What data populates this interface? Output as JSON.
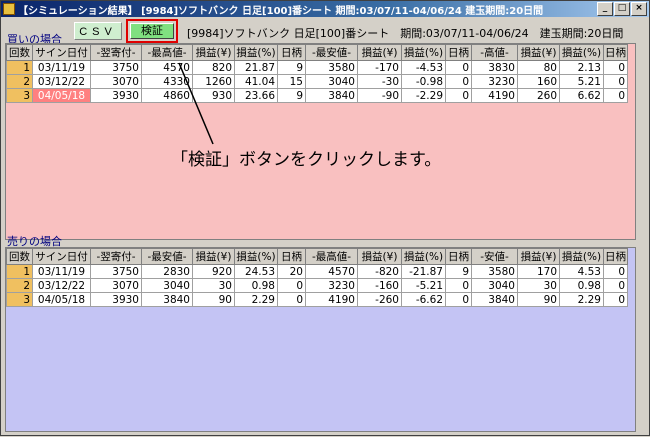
{
  "window": {
    "title": "【シミュレーション結果】 [9984]ソフトバンク 日足[100]番シート 期間:03/07/11-04/06/24 建玉期間:20日間",
    "min_label": "_",
    "max_label": "□",
    "close_label": "×"
  },
  "toolbar": {
    "csv_label": "CSV",
    "verify_label": "検証",
    "info": "[9984]ソフトバンク 日足[100]番シート　期間:03/07/11-04/06/24　建玉期間:20日間"
  },
  "buy": {
    "label": "買いの場合",
    "headers": [
      "回数",
      "サイン日付",
      "-翌寄付-",
      "-最高値-",
      "損益(¥)",
      "損益(%)",
      "日柄",
      "-最安値-",
      "損益(¥)",
      "損益(%)",
      "日柄",
      "-高値-",
      "損益(¥)",
      "損益(%)",
      "日柄"
    ],
    "rows": [
      [
        "1",
        "03/11/19",
        "3750",
        "4570",
        "820",
        "21.87",
        "9",
        "3580",
        "-170",
        "-4.53",
        "0",
        "3830",
        "80",
        "2.13",
        "0"
      ],
      [
        "2",
        "03/12/22",
        "3070",
        "4330",
        "1260",
        "41.04",
        "15",
        "3040",
        "-30",
        "-0.98",
        "0",
        "3230",
        "160",
        "5.21",
        "0"
      ],
      [
        "3",
        "04/05/18",
        "3930",
        "4860",
        "930",
        "23.66",
        "9",
        "3840",
        "-90",
        "-2.29",
        "0",
        "4190",
        "260",
        "6.62",
        "0"
      ]
    ]
  },
  "sell": {
    "label": "売りの場合",
    "headers": [
      "回数",
      "サイン日付",
      "-翌寄付-",
      "-最安値-",
      "損益(¥)",
      "損益(%)",
      "日柄",
      "-最高値-",
      "損益(¥)",
      "損益(%)",
      "日柄",
      "-安値-",
      "損益(¥)",
      "損益(%)",
      "日柄"
    ],
    "rows": [
      [
        "1",
        "03/11/19",
        "3750",
        "2830",
        "920",
        "24.53",
        "20",
        "4570",
        "-820",
        "-21.87",
        "9",
        "3580",
        "170",
        "4.53",
        "0"
      ],
      [
        "2",
        "03/12/22",
        "3070",
        "3040",
        "30",
        "0.98",
        "0",
        "3230",
        "-160",
        "-5.21",
        "0",
        "3040",
        "30",
        "0.98",
        "0"
      ],
      [
        "3",
        "04/05/18",
        "3930",
        "3840",
        "90",
        "2.29",
        "0",
        "4190",
        "-260",
        "-6.62",
        "0",
        "3840",
        "90",
        "2.29",
        "0"
      ]
    ]
  },
  "callout": "「検証」ボタンをクリックします。",
  "colors": {
    "highlight": "#e00000",
    "buy_bg": "#f9c0c0",
    "sell_bg": "#c4c4f4"
  }
}
